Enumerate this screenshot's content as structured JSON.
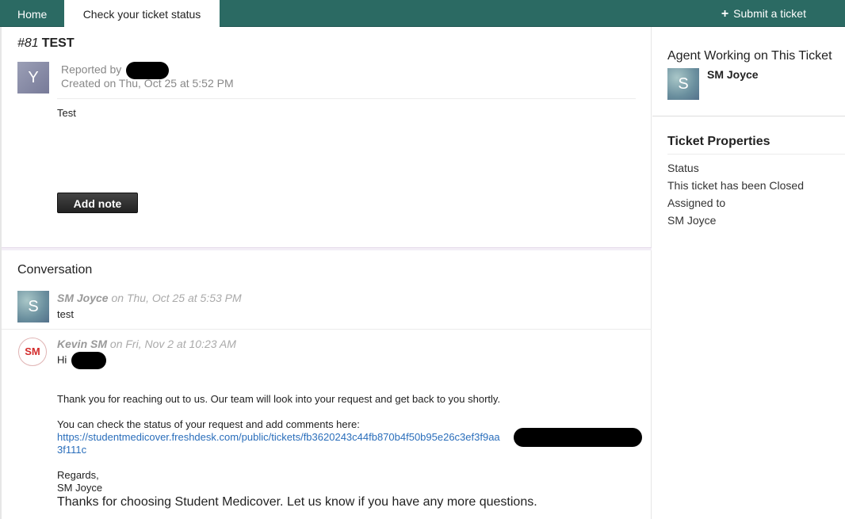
{
  "nav": {
    "home": "Home",
    "active_tab": "Check your ticket status",
    "submit": "Submit a ticket"
  },
  "ticket": {
    "number": "#81",
    "subject": "TEST",
    "reporter_avatar": "Y",
    "reported_by": "Reported by",
    "created": "Created on Thu, Oct 25 at 5:52 PM",
    "description": "Test",
    "add_note": "Add note"
  },
  "conversation": {
    "title": "Conversation",
    "messages": [
      {
        "avatar": "S",
        "author": "SM Joyce",
        "when": " on Thu, Oct 25 at 5:53 PM",
        "body": "test"
      },
      {
        "avatar": "SM",
        "author": "Kevin SM",
        "when": " on Fri, Nov 2 at 10:23 AM",
        "greeting": "Hi",
        "line1": "Thank you for reaching out to us. Our team will look into your request and get back to you shortly.",
        "line2": "You can check the status of your request and add comments here:",
        "link1": "https://studentmedicover.freshdesk.com/public/tickets/fb3620243c44fb870b4f50b95e26c3ef3f9aa",
        "link2": "3f111c",
        "regards": "Regards,",
        "signature": "SM Joyce",
        "closing": "Thanks for choosing Student Medicover. Let us know if you have any more questions."
      }
    ]
  },
  "sidebar": {
    "agent_heading": "Agent Working on This Ticket",
    "agent_avatar": "S",
    "agent_name": "SM Joyce",
    "props_heading": "Ticket Properties",
    "status_label": "Status",
    "status_value": "This ticket has been Closed",
    "assigned_label": "Assigned to",
    "assigned_value": "SM Joyce"
  },
  "colors": {
    "nav_bg": "#2b6a63",
    "link": "#2a6ebb",
    "button_bg": "#333333"
  }
}
